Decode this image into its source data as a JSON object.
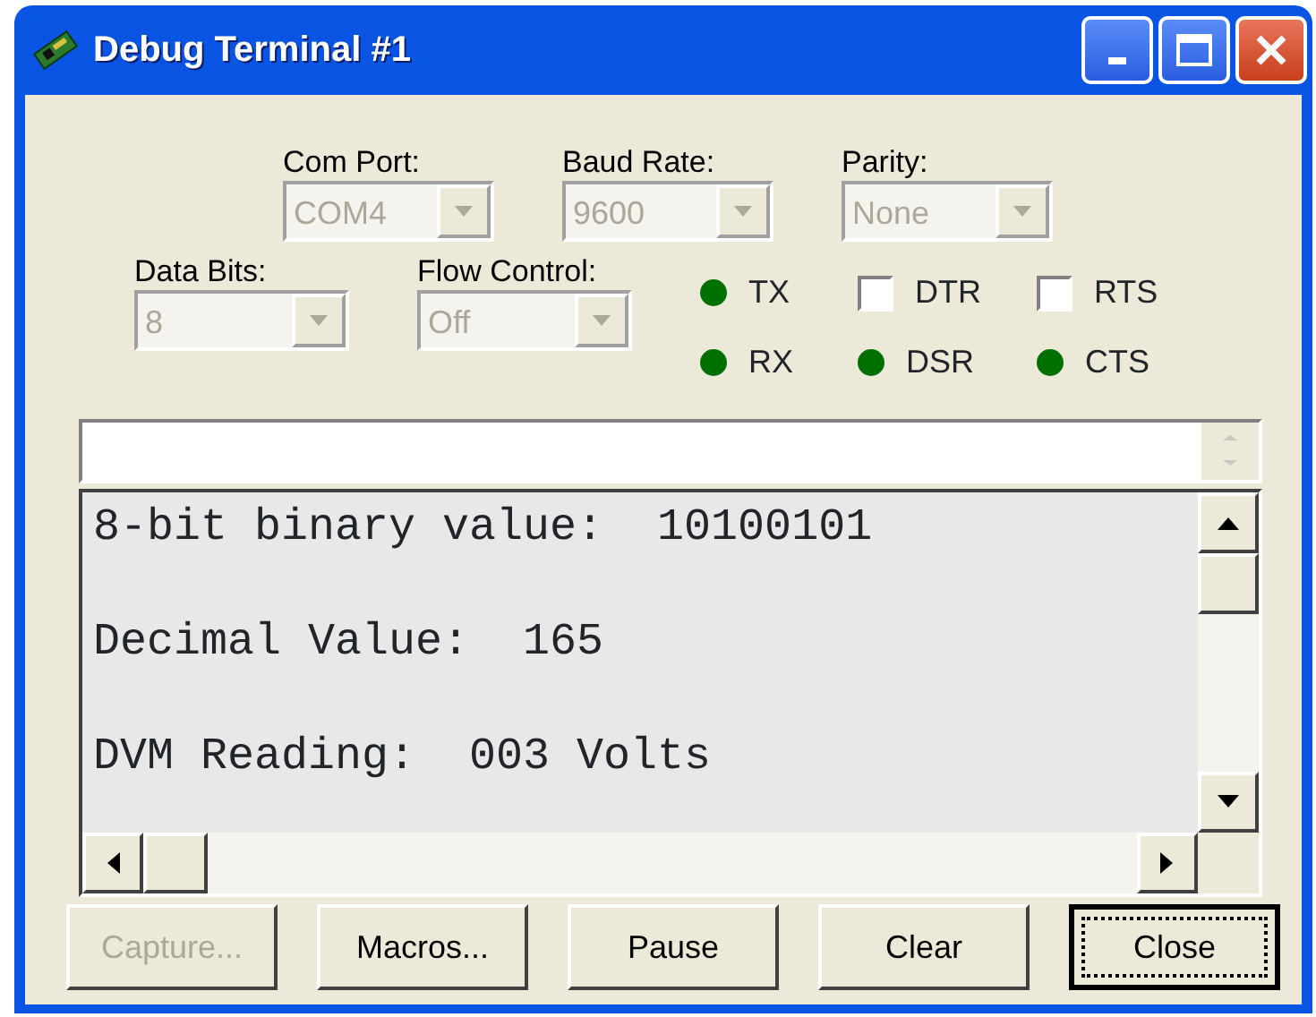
{
  "window": {
    "title": "Debug Terminal #1"
  },
  "port_settings": [
    {
      "label": "Com Port:",
      "value": "COM4",
      "disabled": true
    },
    {
      "label": "Baud Rate:",
      "value": "9600",
      "disabled": true
    },
    {
      "label": "Parity:",
      "value": "None",
      "disabled": true
    },
    {
      "label": "Data Bits:",
      "value": "8",
      "disabled": true
    },
    {
      "label": "Flow Control:",
      "value": "Off",
      "disabled": true
    }
  ],
  "signals": [
    {
      "kind": "led",
      "label": "TX",
      "color": "#007000"
    },
    {
      "kind": "checkbox",
      "label": "DTR",
      "checked": false
    },
    {
      "kind": "checkbox",
      "label": "RTS",
      "checked": false
    },
    {
      "kind": "led",
      "label": "RX",
      "color": "#007000"
    },
    {
      "kind": "led",
      "label": "DSR",
      "color": "#007000"
    },
    {
      "kind": "led",
      "label": "CTS",
      "color": "#007000"
    }
  ],
  "terminal": {
    "lines": [
      "8-bit binary value:  10100101",
      "Decimal Value:  165",
      "DVM Reading:  003 Volts"
    ]
  },
  "buttons": [
    {
      "label": "Capture...",
      "disabled": true,
      "default": false
    },
    {
      "label": "Macros...",
      "disabled": false,
      "default": false
    },
    {
      "label": "Pause",
      "disabled": false,
      "default": false
    },
    {
      "label": "Clear",
      "disabled": false,
      "default": false
    },
    {
      "label": "Close",
      "disabled": false,
      "default": true
    }
  ]
}
